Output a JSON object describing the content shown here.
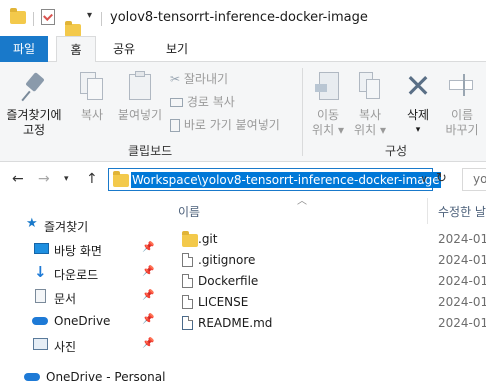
{
  "window": {
    "title": "yolov8-tensorrt-inference-docker-image"
  },
  "ribbon_tabs": [
    "파일",
    "홈",
    "공유",
    "보기"
  ],
  "ribbon": {
    "pin_label_1": "즐겨찾기에",
    "pin_label_2": "고정",
    "copy": "복사",
    "paste": "붙여넣기",
    "cut": "잘라내기",
    "copy_path": "경로 복사",
    "paste_shortcut": "바로 가기 붙여넣기",
    "move_to_1": "이동",
    "move_to_2": "위치",
    "copy_to_1": "복사",
    "copy_to_2": "위치",
    "delete": "삭제",
    "rename_1": "이름",
    "rename_2": "바꾸기",
    "group_clipboard": "클립보드",
    "group_organize": "구성"
  },
  "address": {
    "path": "Workspace\\yolov8-tensorrt-inference-docker-image",
    "search_text": "yo"
  },
  "nav": {
    "quick_access": "즐겨찾기",
    "desktop": "바탕 화면",
    "downloads": "다운로드",
    "documents": "문서",
    "onedrive": "OneDrive",
    "pictures": "사진",
    "onedrive_personal": "OneDrive - Personal"
  },
  "columns": {
    "name": "이름",
    "modified": "수정한 날"
  },
  "files": [
    {
      "name": ".git",
      "date": "2024-01",
      "icon": "folder-icon"
    },
    {
      "name": ".gitignore",
      "date": "2024-01",
      "icon": "text-file-icon"
    },
    {
      "name": "Dockerfile",
      "date": "2024-01",
      "icon": "file-icon"
    },
    {
      "name": "LICENSE",
      "date": "2024-01",
      "icon": "file-icon"
    },
    {
      "name": "README.md",
      "date": "2024-01",
      "icon": "markdown-file-icon"
    }
  ],
  "colors": {
    "accent": "#1979ca",
    "selection": "#0078d7",
    "folder": "#f3c94b"
  }
}
